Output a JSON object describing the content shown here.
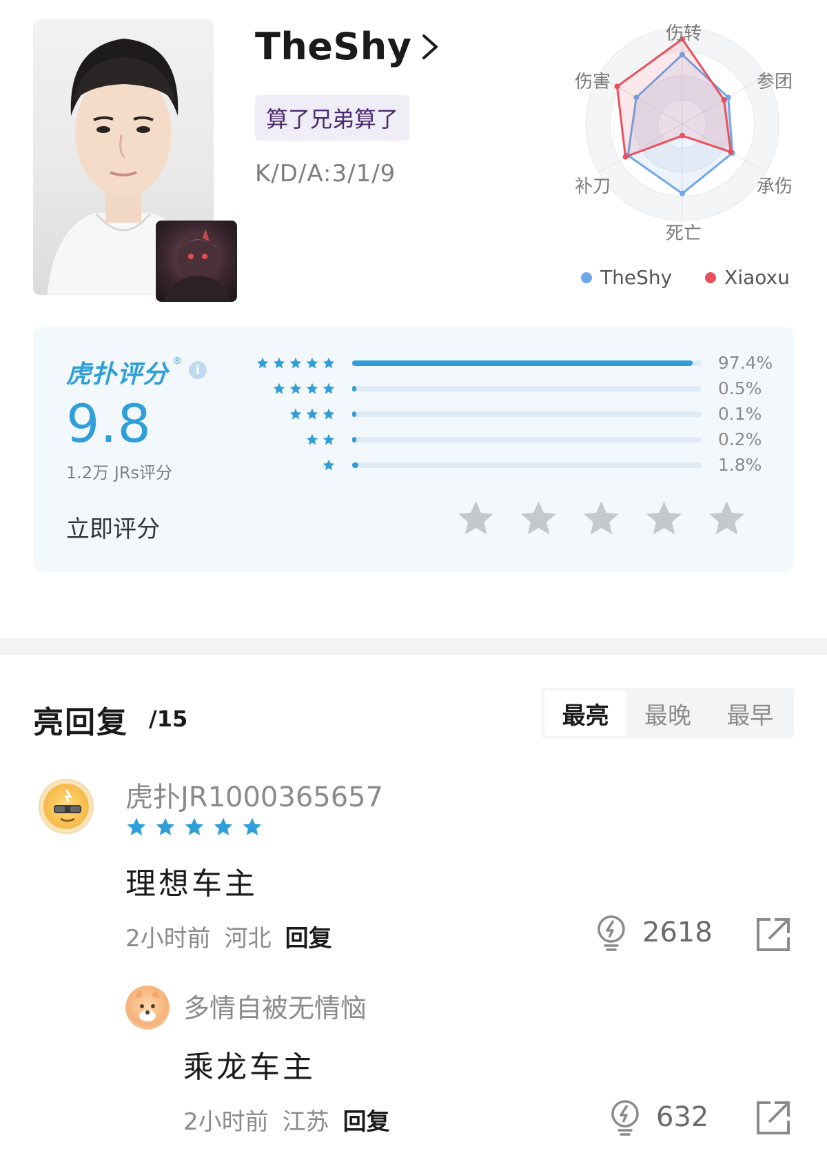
{
  "player": {
    "name": "TheShy",
    "tag": "算了兄弟算了",
    "kda": "K/D/A:3/1/9"
  },
  "radar": {
    "axes": [
      "伤转",
      "参团",
      "承伤",
      "死亡",
      "补刀",
      "伤害"
    ],
    "series": [
      {
        "name": "TheShy",
        "color": "#6ea6ea",
        "values": [
          0.72,
          0.55,
          0.6,
          0.72,
          0.65,
          0.55
        ]
      },
      {
        "name": "Xiaoxu",
        "color": "#e8505b",
        "values": [
          0.88,
          0.5,
          0.58,
          0.12,
          0.68,
          0.78
        ]
      }
    ]
  },
  "rating": {
    "brand": "虎扑评分",
    "registered": "®",
    "info_icon": "i",
    "score": "9.8",
    "count": "1.2万 JRs评分",
    "rate_now": "立即评分",
    "distribution": [
      {
        "stars": 5,
        "percent": "97.4%",
        "value": 97.4
      },
      {
        "stars": 4,
        "percent": "0.5%",
        "value": 0.5
      },
      {
        "stars": 3,
        "percent": "0.1%",
        "value": 0.1
      },
      {
        "stars": 2,
        "percent": "0.2%",
        "value": 0.2
      },
      {
        "stars": 1,
        "percent": "1.8%",
        "value": 1.8
      }
    ],
    "accent_color": "#2f9ed9"
  },
  "replies": {
    "title": "亮回复",
    "count": "/15",
    "tabs": [
      {
        "label": "最亮",
        "active": true
      },
      {
        "label": "最晚",
        "active": false
      },
      {
        "label": "最早",
        "active": false
      }
    ]
  },
  "comments": [
    {
      "username": "虎扑JR1000365657",
      "rating_stars": 5,
      "text": "理想车主",
      "time": "2小时前",
      "location": "河北",
      "reply_label": "回复",
      "lights": "2618"
    },
    {
      "username": "多情自被无情恼",
      "text": "乘龙车主",
      "time": "2小时前",
      "location": "江苏",
      "reply_label": "回复",
      "lights": "632"
    }
  ]
}
